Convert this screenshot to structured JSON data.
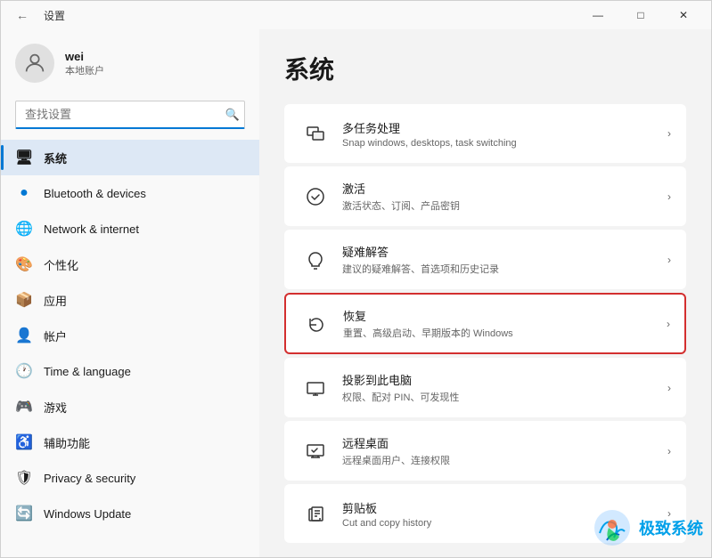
{
  "window": {
    "title": "设置",
    "controls": {
      "minimize": "—",
      "maximize": "□",
      "close": "✕"
    }
  },
  "sidebar": {
    "user": {
      "name": "wei",
      "type": "本地账户"
    },
    "search": {
      "placeholder": "查找设置",
      "value": ""
    },
    "items": [
      {
        "id": "system",
        "label": "系统",
        "icon": "🖥",
        "active": true
      },
      {
        "id": "bluetooth",
        "label": "Bluetooth & devices",
        "icon": "🔵",
        "active": false
      },
      {
        "id": "network",
        "label": "Network & internet",
        "icon": "🌐",
        "active": false
      },
      {
        "id": "personalization",
        "label": "个性化",
        "icon": "🎨",
        "active": false
      },
      {
        "id": "apps",
        "label": "应用",
        "icon": "📦",
        "active": false
      },
      {
        "id": "accounts",
        "label": "帐户",
        "icon": "👤",
        "active": false
      },
      {
        "id": "time",
        "label": "Time & language",
        "icon": "🕐",
        "active": false
      },
      {
        "id": "gaming",
        "label": "游戏",
        "icon": "🎮",
        "active": false
      },
      {
        "id": "accessibility",
        "label": "辅助功能",
        "icon": "♿",
        "active": false
      },
      {
        "id": "privacy",
        "label": "Privacy & security",
        "icon": "🛡",
        "active": false
      },
      {
        "id": "update",
        "label": "Windows Update",
        "icon": "🔄",
        "active": false
      }
    ]
  },
  "main": {
    "title": "系统",
    "items": [
      {
        "id": "multitasking",
        "title": "多任务处理",
        "subtitle": "Snap windows, desktops, task switching",
        "highlighted": false
      },
      {
        "id": "activation",
        "title": "激活",
        "subtitle": "激活状态、订阅、产品密钥",
        "highlighted": false
      },
      {
        "id": "troubleshoot",
        "title": "疑难解答",
        "subtitle": "建议的疑难解答、首选项和历史记录",
        "highlighted": false
      },
      {
        "id": "recovery",
        "title": "恢复",
        "subtitle": "重置、高级启动、早期版本的 Windows",
        "highlighted": true
      },
      {
        "id": "projecting",
        "title": "投影到此电脑",
        "subtitle": "权限、配对 PIN、可发现性",
        "highlighted": false
      },
      {
        "id": "remotedesktop",
        "title": "远程桌面",
        "subtitle": "远程桌面用户、连接权限",
        "highlighted": false
      },
      {
        "id": "clipboard",
        "title": "剪贴板",
        "subtitle": "Cut and copy history",
        "highlighted": false
      }
    ]
  },
  "watermark": {
    "text": "极致系统"
  }
}
